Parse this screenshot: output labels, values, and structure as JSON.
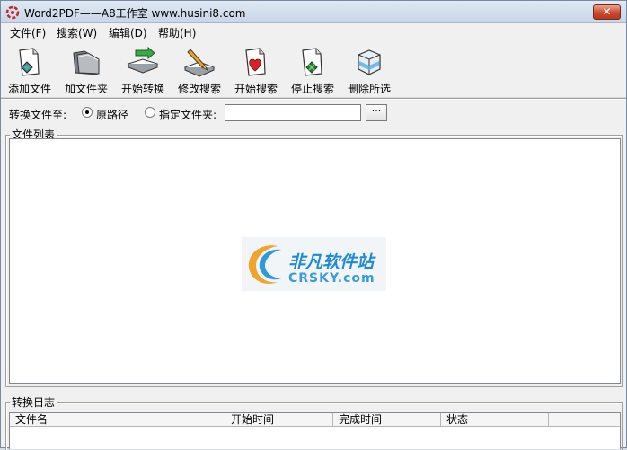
{
  "window": {
    "title": "Word2PDF——A8工作室 www.husini8.com",
    "close_label": "✕"
  },
  "menu": [
    {
      "label": "文件(F)"
    },
    {
      "label": "搜索(W)"
    },
    {
      "label": "编辑(D)"
    },
    {
      "label": "帮助(H)"
    }
  ],
  "toolbar": [
    {
      "label": "添加文件",
      "icon": "add-file-icon"
    },
    {
      "label": "加文件夹",
      "icon": "add-folder-icon"
    },
    {
      "label": "开始转换",
      "icon": "start-convert-icon"
    },
    {
      "label": "修改搜索",
      "icon": "edit-search-icon"
    },
    {
      "label": "开始搜索",
      "icon": "start-search-icon"
    },
    {
      "label": "停止搜索",
      "icon": "stop-search-icon"
    },
    {
      "label": "删除所选",
      "icon": "delete-selected-icon"
    }
  ],
  "convert_to": {
    "label": "转换文件至:",
    "option_original": "原路径",
    "option_folder": "指定文件夹:",
    "selected": "原路径",
    "folder_value": "",
    "browse_label": "···"
  },
  "file_list": {
    "title": "文件列表"
  },
  "watermark": {
    "title": "非凡软件站",
    "subtitle": "CRSKY.com"
  },
  "log": {
    "title": "转换日志",
    "columns": [
      "文件名",
      "开始时间",
      "完成时间",
      "状态"
    ]
  },
  "colors": {
    "accent": "#1f8ad3",
    "close": "#c9482a"
  }
}
